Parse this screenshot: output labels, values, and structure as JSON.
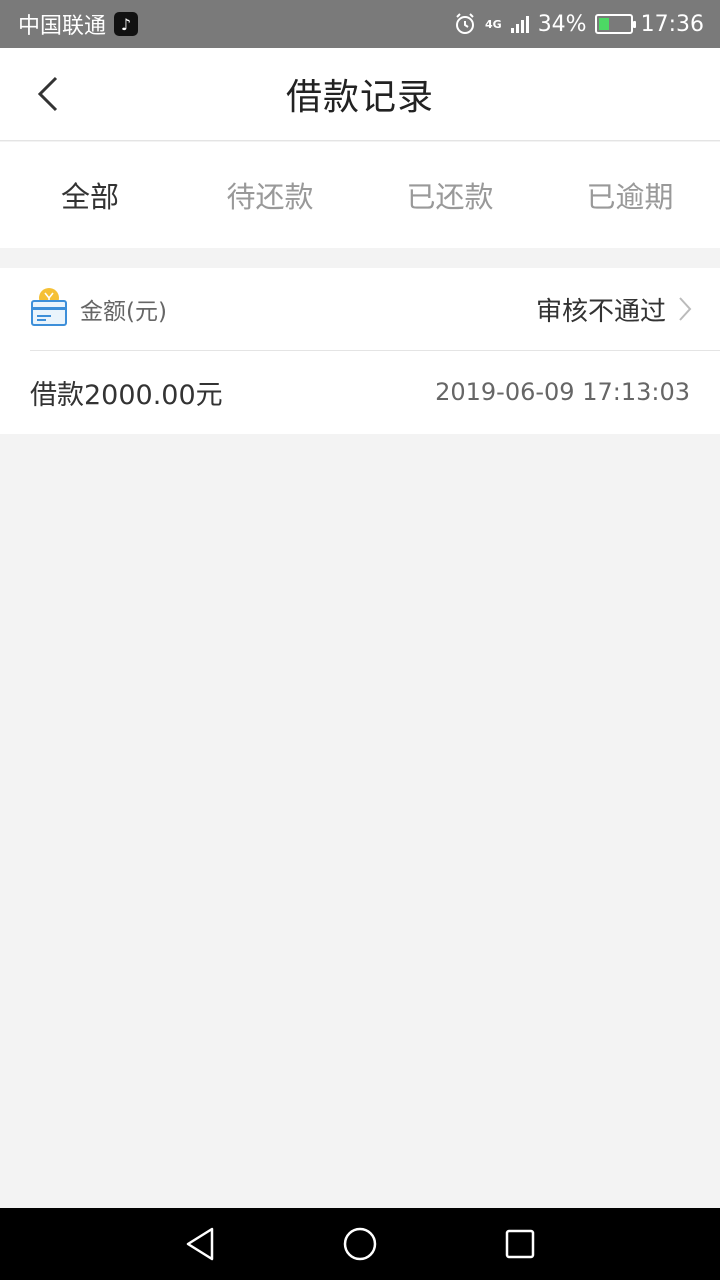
{
  "status_bar": {
    "carrier": "中国联通",
    "network": "4G",
    "battery_percent": "34%",
    "battery_level": 0.34,
    "time": "17:36",
    "icons": [
      "tiktok-icon",
      "alarm-icon",
      "signal-icon",
      "battery-icon"
    ]
  },
  "header": {
    "title": "借款记录",
    "back_icon": "chevron-left-icon"
  },
  "tabs": [
    {
      "label": "全部",
      "active": true
    },
    {
      "label": "待还款",
      "active": false
    },
    {
      "label": "已还款",
      "active": false
    },
    {
      "label": "已逾期",
      "active": false
    }
  ],
  "record": {
    "icon": "card-coin-icon",
    "amount_label": "金额(元)",
    "status": "审核不通过",
    "loan_text": "借款2000.00元",
    "time": "2019-06-09 17:13:03"
  },
  "nav_bar": {
    "icons": [
      "back-triangle-icon",
      "home-circle-icon",
      "recents-square-icon"
    ]
  },
  "colors": {
    "status_bar_bg": "#7a7a7a",
    "page_bg": "#f3f3f3",
    "active_tab": "#333333",
    "inactive_tab": "#999999",
    "card_icon_blue": "#3d8fd9",
    "coin_yellow": "#f5c035"
  }
}
